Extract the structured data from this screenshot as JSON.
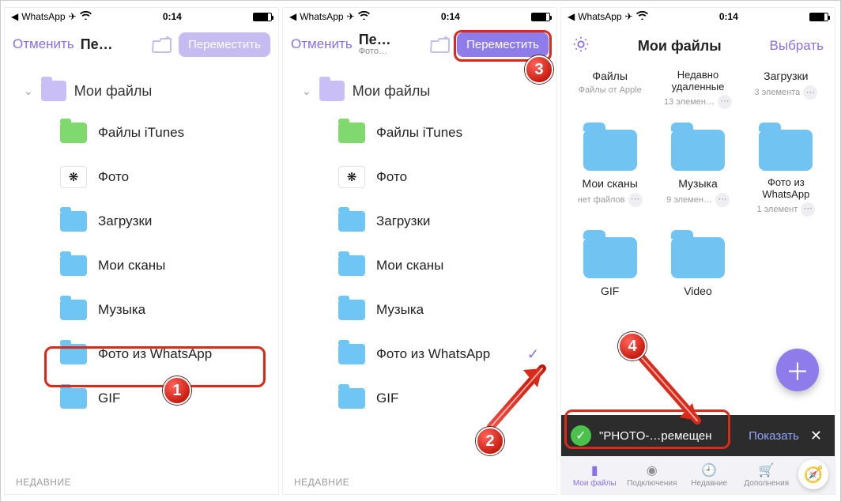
{
  "status": {
    "back_app": "WhatsApp",
    "time": "0:14"
  },
  "screen1": {
    "nav": {
      "cancel": "Отменить",
      "title": "Пе…",
      "move": "Переместить"
    },
    "root": "Мои файлы",
    "items": [
      {
        "label": "Файлы iTunes"
      },
      {
        "label": "Фото"
      },
      {
        "label": "Загрузки"
      },
      {
        "label": "Мои сканы"
      },
      {
        "label": "Музыка"
      },
      {
        "label": "Фото из  WhatsApp"
      },
      {
        "label": "GIF"
      }
    ],
    "recents": "НЕДАВНИЕ"
  },
  "screen2": {
    "nav": {
      "cancel": "Отменить",
      "title": "Пе…",
      "subtitle": "Фото…",
      "move": "Переместить"
    },
    "root": "Мои файлы",
    "items": [
      {
        "label": "Файлы iTunes"
      },
      {
        "label": "Фото"
      },
      {
        "label": "Загрузки"
      },
      {
        "label": "Мои сканы"
      },
      {
        "label": "Музыка"
      },
      {
        "label": "Фото из  WhatsApp"
      },
      {
        "label": "GIF"
      }
    ],
    "recents": "НЕДАВНИЕ"
  },
  "screen3": {
    "nav": {
      "title": "Мои файлы",
      "select": "Выбрать"
    },
    "row1": [
      {
        "title": "Файлы",
        "meta": "Файлы от Apple"
      },
      {
        "title": "Недавно удаленные",
        "meta": "13 элемен…"
      },
      {
        "title": "Загрузки",
        "meta": "3 элемента"
      }
    ],
    "row2": [
      {
        "title": "Мои сканы",
        "meta": "нет файлов"
      },
      {
        "title": "Музыка",
        "meta": "9 элемен…"
      },
      {
        "title": "Фото из WhatsApp",
        "meta": "1 элемент"
      }
    ],
    "row3": [
      {
        "title": "GIF"
      },
      {
        "title": "Video"
      }
    ],
    "toast": {
      "msg": "\"PHOTO-…ремещен",
      "show": "Показать"
    },
    "tabs": {
      "files": "Мои файлы",
      "connections": "Подключения",
      "recent": "Недавние",
      "addons": "Дополнения"
    }
  },
  "steps": {
    "s1": "1",
    "s2": "2",
    "s3": "3",
    "s4": "4"
  }
}
